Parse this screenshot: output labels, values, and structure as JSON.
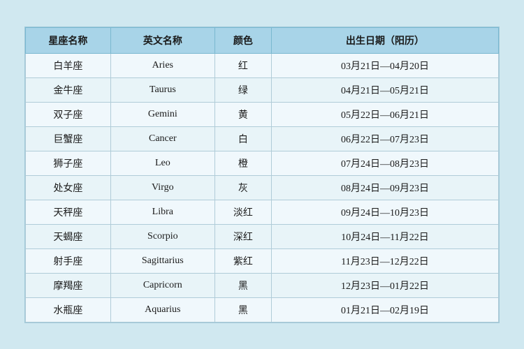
{
  "table": {
    "headers": {
      "chinese_name": "星座名称",
      "english_name": "英文名称",
      "color": "颜色",
      "date": "出生日期（阳历）"
    },
    "rows": [
      {
        "chinese": "白羊座",
        "english": "Aries",
        "color": "红",
        "date": "03月21日—04月20日"
      },
      {
        "chinese": "金牛座",
        "english": "Taurus",
        "color": "绿",
        "date": "04月21日—05月21日"
      },
      {
        "chinese": "双子座",
        "english": "Gemini",
        "color": "黄",
        "date": "05月22日—06月21日"
      },
      {
        "chinese": "巨蟹座",
        "english": "Cancer",
        "color": "白",
        "date": "06月22日—07月23日"
      },
      {
        "chinese": "狮子座",
        "english": "Leo",
        "color": "橙",
        "date": "07月24日—08月23日"
      },
      {
        "chinese": "处女座",
        "english": "Virgo",
        "color": "灰",
        "date": "08月24日—09月23日"
      },
      {
        "chinese": "天秤座",
        "english": "Libra",
        "color": "淡红",
        "date": "09月24日—10月23日"
      },
      {
        "chinese": "天蝎座",
        "english": "Scorpio",
        "color": "深红",
        "date": "10月24日—11月22日"
      },
      {
        "chinese": "射手座",
        "english": "Sagittarius",
        "color": "紫红",
        "date": "11月23日—12月22日"
      },
      {
        "chinese": "摩羯座",
        "english": "Capricorn",
        "color": "黑",
        "date": "12月23日—01月22日"
      },
      {
        "chinese": "水瓶座",
        "english": "Aquarius",
        "color": "黑",
        "date": "01月21日—02月19日"
      }
    ]
  }
}
